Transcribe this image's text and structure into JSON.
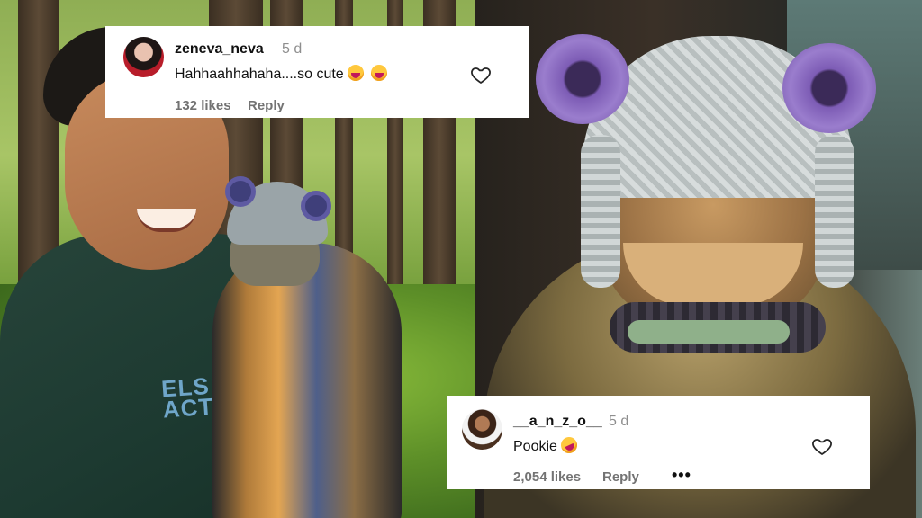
{
  "comments": [
    {
      "username": "zeneva_neva",
      "time": "5 d",
      "text": "Hahhaahhahaha....so cute",
      "emoji": [
        "laughing-face-icon",
        "laughing-face-icon"
      ],
      "likes": "132 likes",
      "reply": "Reply"
    },
    {
      "username": "__a_n_z_o__",
      "time": "5 d",
      "text": "Pookie",
      "emoji": [
        "rofl-face-icon"
      ],
      "likes": "2,054 likes",
      "reply": "Reply",
      "more": "•••"
    }
  ],
  "photo_left": {
    "shirt_logo": "ELS\nACTIVE"
  },
  "colors": {
    "card_bg": "#ffffff",
    "meta_gray": "#737373",
    "hat_purple": "#7d5cb5"
  }
}
